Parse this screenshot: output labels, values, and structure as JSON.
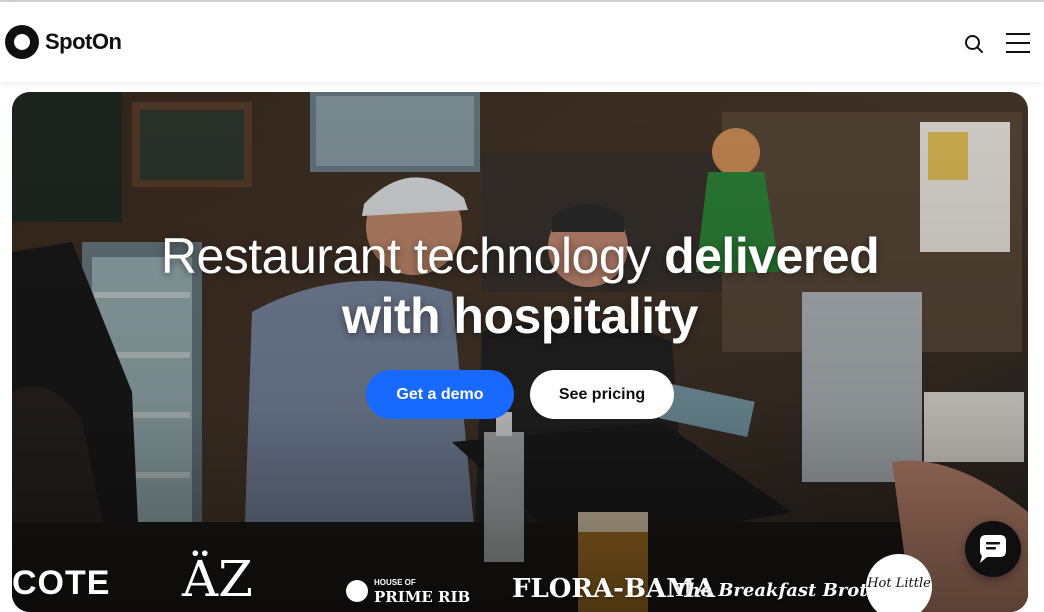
{
  "header": {
    "logo_text": "SpotOn",
    "search_icon": "search-icon",
    "menu_icon": "hamburger-menu-icon"
  },
  "hero": {
    "headline_light": "Restaurant technology",
    "headline_bold_1": "delivered",
    "headline_bold_2": "with hospitality",
    "demo_button": "Get a demo",
    "pricing_button": "See pricing"
  },
  "customer_logos": {
    "cote": "COTE",
    "aa": "ÄZ",
    "house_of": "HOUSE OF",
    "prime_rib": "PRIME RIB",
    "flora_bama": "FLORA-BAMA",
    "breakfast_brothers": "The Breakfast Brothers",
    "hot_little": "Hot Little"
  },
  "chat": {
    "icon": "chat-bubble-icon"
  },
  "colors": {
    "primary": "#1769ff",
    "dark": "#0f0f10",
    "white": "#ffffff"
  }
}
